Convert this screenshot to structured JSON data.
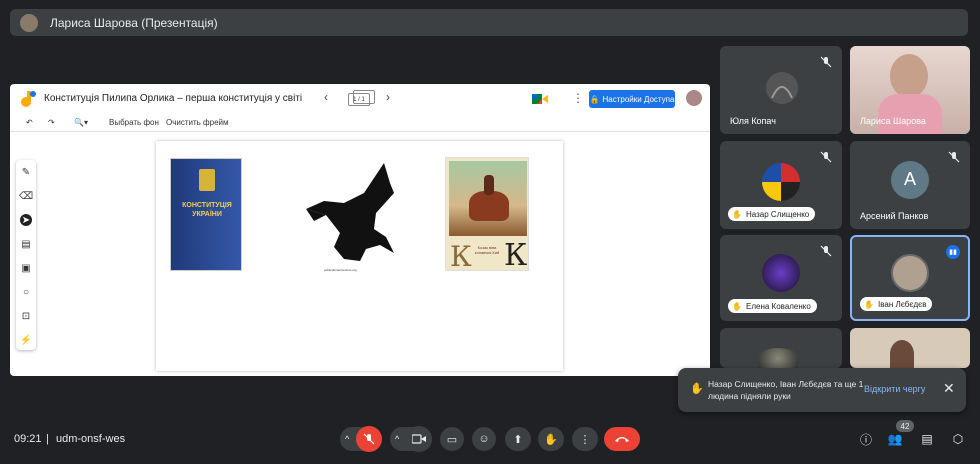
{
  "header": {
    "presenter_title": "Лариса Шарова (Презентація)"
  },
  "jamboard": {
    "title": "Конституція Пилипа Орлика – перша конституція у світі",
    "frame_counter": "1 / 1",
    "share_label": "Настройки Доступа",
    "toolbar": {
      "set_background": "Выбрать фон",
      "clear_frame": "Очистить фрейм"
    },
    "canvas": {
      "book_text": "КОНСТИТУЦІЯ УКРАЇНИ",
      "eagle_caption": "publicdomainvectors.org",
      "book2_letter_left": "К",
      "book2_letter_right": "К",
      "book2_small": "Козак віва конавчик Кий"
    }
  },
  "participants": [
    {
      "name": "Юля Копач",
      "muted": true
    },
    {
      "name": "Лариса Шарова",
      "muted": false
    },
    {
      "name": "Назар Слищенко",
      "muted": true,
      "hand_raised": true
    },
    {
      "name": "Арсений Панков",
      "muted": true,
      "initial": "A"
    },
    {
      "name": "Елена Коваленко",
      "muted": true,
      "hand_raised": true
    },
    {
      "name": "Іван Лєбєдєв",
      "muted": false,
      "hand_raised": true,
      "speaking": true
    }
  ],
  "toast": {
    "message": "Назар Слищенко, Іван Лєбєдєв та ще 1 людина підняли руки",
    "action": "Відкрити чергу"
  },
  "footer": {
    "time": "09:21",
    "separator": "|",
    "meeting_code": "udm-onsf-wes",
    "people_count": "42"
  },
  "colors": {
    "accent": "#1a73e8",
    "end_call": "#ea4335",
    "link": "#8ab4f8",
    "speaking": "#8ab4f8"
  }
}
